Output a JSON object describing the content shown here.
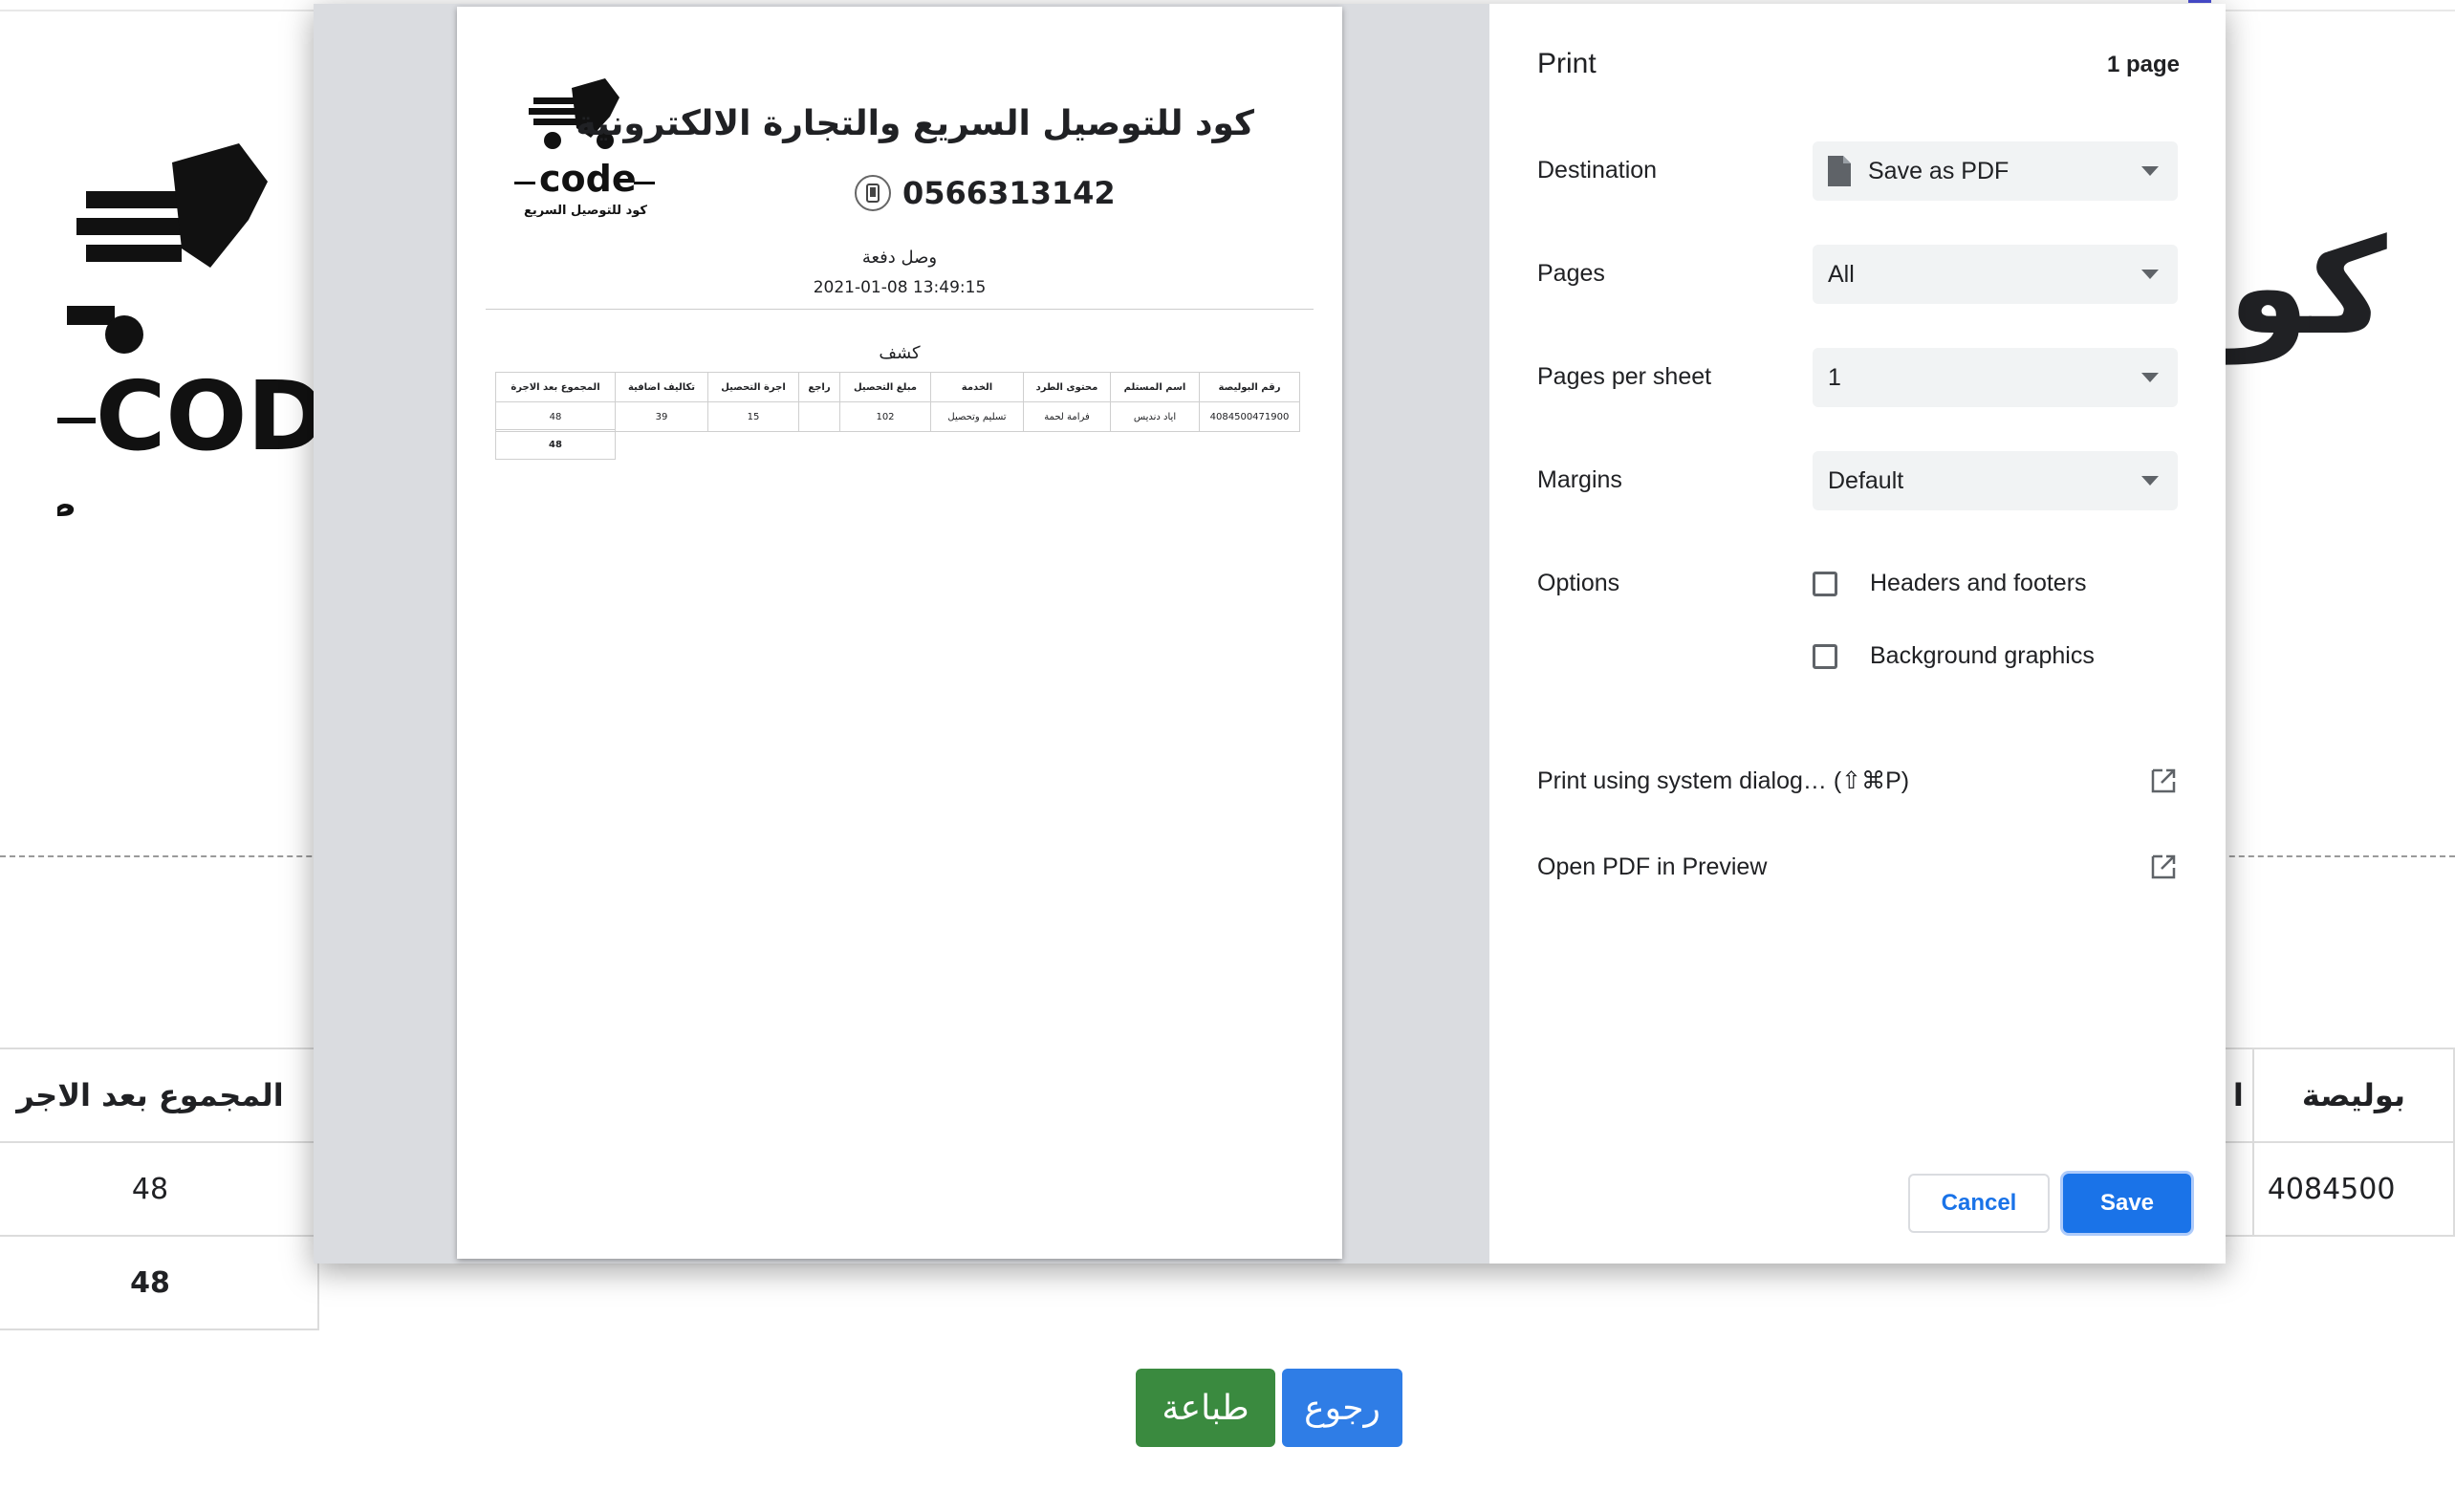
{
  "background": {
    "title_fragment": "كو",
    "table_left": {
      "header": "المجموع بعد الاجر",
      "value": "48",
      "total": "48"
    },
    "table_right": {
      "header_partial": "ا",
      "header": "بوليصة",
      "value": "4084500"
    },
    "buttons": {
      "print": "طباعة",
      "back": "رجوع"
    }
  },
  "preview": {
    "company_name": "كود للتوصيل السريع والتجارة الالكترونية",
    "phone": "0566313142",
    "subtitle": "وصل دفعة",
    "datetime": "2021-01-08 13:49:15",
    "statement_title": "كشف",
    "table": {
      "headers": [
        "رقم البوليصة",
        "اسم المستلم",
        "محتوى الطرد",
        "الخدمة",
        "مبلغ التحصيل",
        "راجع",
        "اجرة التحصيل",
        "تكاليف اضافية",
        "المجموع بعد الاجرة"
      ],
      "row": [
        "4084500471900",
        "اياد دنديس",
        "فرامة لحمة",
        "تسليم وتحصيل",
        "102",
        "",
        "15",
        "39",
        "48"
      ],
      "total": "48"
    }
  },
  "print_dialog": {
    "title": "Print",
    "page_count": "1 page",
    "destination": {
      "label": "Destination",
      "value": "Save as PDF"
    },
    "pages": {
      "label": "Pages",
      "value": "All"
    },
    "pages_per_sheet": {
      "label": "Pages per sheet",
      "value": "1"
    },
    "margins": {
      "label": "Margins",
      "value": "Default"
    },
    "options": {
      "label": "Options",
      "headers_footers": "Headers and footers",
      "background_graphics": "Background graphics"
    },
    "system_dialog": "Print using system dialog… (⇧⌘P)",
    "open_pdf": "Open PDF in Preview",
    "cancel": "Cancel",
    "save": "Save"
  },
  "colors": {
    "accent": "#1a73e8",
    "print_button": "#3a8a3f",
    "back_button": "#2f7de6"
  }
}
